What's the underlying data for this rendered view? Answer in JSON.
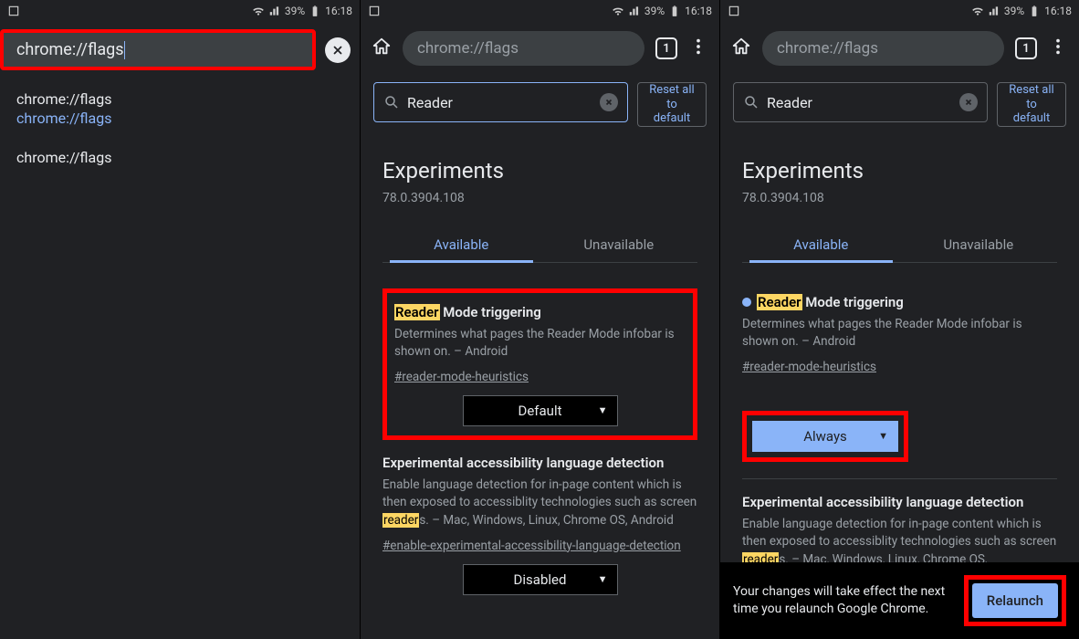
{
  "status": {
    "battery": "39%",
    "time": "16:18"
  },
  "screen1": {
    "addr_value": "chrome://flags",
    "suggest1_top": "chrome://flags",
    "suggest1_sub": "chrome://flags",
    "suggest2": "chrome://flags"
  },
  "screen2": {
    "url": "chrome://flags",
    "tab_count": "1",
    "search_value": "Reader",
    "reset_label": "Reset all to default",
    "exp_heading": "Experiments",
    "version": "78.0.3904.108",
    "tab_available": "Available",
    "tab_unavailable": "Unavailable",
    "flag1": {
      "hl": "Reader",
      "title_rest": " Mode triggering",
      "desc": "Determines what pages the Reader Mode infobar is shown on. – Android",
      "hash": "#reader-mode-heuristics",
      "dropdown": "Default"
    },
    "flag2": {
      "title": "Experimental accessibility language detection",
      "desc_pre": "Enable language detection for in-page content which is then exposed to accessiblity technologies such as screen ",
      "desc_hl": "reader",
      "desc_post": "s. – Mac, Windows, Linux, Chrome OS, Android",
      "hash": "#enable-experimental-accessibility-language-detection",
      "dropdown": "Disabled"
    }
  },
  "screen3": {
    "url": "chrome://flags",
    "tab_count": "1",
    "search_value": "Reader",
    "reset_label": "Reset all to default",
    "exp_heading": "Experiments",
    "version": "78.0.3904.108",
    "tab_available": "Available",
    "tab_unavailable": "Unavailable",
    "flag1": {
      "hl": "Reader",
      "title_rest": " Mode triggering",
      "desc": "Determines what pages the Reader Mode infobar is shown on. – Android",
      "hash": "#reader-mode-heuristics",
      "dropdown": "Always"
    },
    "flag2": {
      "title": "Experimental accessibility language detection",
      "desc_pre": "Enable language detection for in-page content which is then exposed to accessiblity technologies such as screen ",
      "desc_hl": "reader",
      "desc_post": "s. – Mac, Windows, Linux, Chrome OS,"
    },
    "relaunch_text": "Your changes will take effect the next time you relaunch Google Chrome.",
    "relaunch_btn": "Relaunch"
  }
}
